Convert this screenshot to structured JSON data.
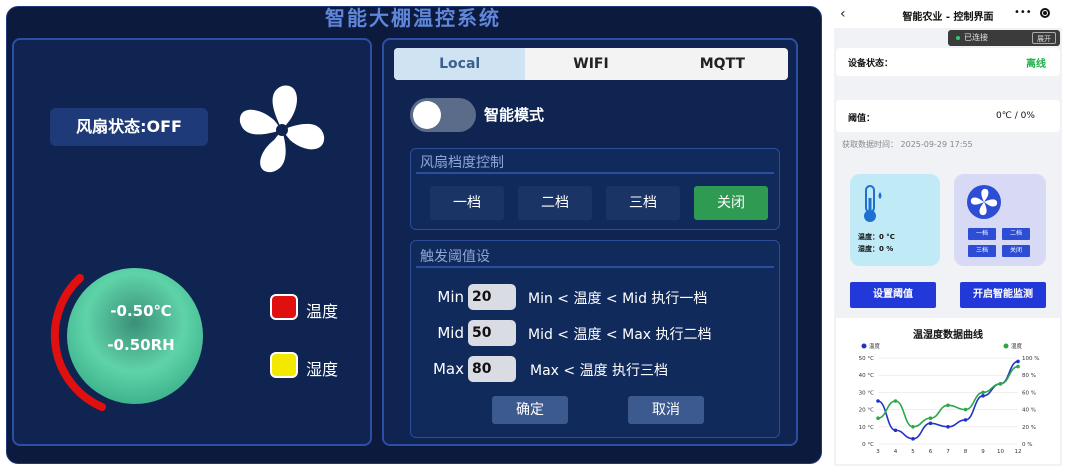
{
  "hmi": {
    "title": "智能大棚温控系统",
    "fan_status": "风扇状态:OFF",
    "temperature": "-0.50℃",
    "humidity": "-0.50RH",
    "legend": [
      {
        "label": "温度",
        "color": "#e01010"
      },
      {
        "label": "湿度",
        "color": "#f2e800"
      }
    ],
    "tabs": [
      "Local",
      "WIFI",
      "MQTT"
    ],
    "active_tab": "Local",
    "smart_mode_label": "智能模式",
    "smart_mode_on": false,
    "speed_title": "风扇档度控制",
    "speed_buttons": [
      "一档",
      "二档",
      "三档",
      "关闭"
    ],
    "active_speed": "关闭",
    "threshold_title": "触发阈值设",
    "thresholds": [
      {
        "label": "Min",
        "value": "20",
        "desc": "Min < 温度 < Mid 执行一档"
      },
      {
        "label": "Mid",
        "value": "50",
        "desc": "Mid < 温度 < Max 执行二档"
      },
      {
        "label": "Max",
        "value": "80",
        "desc": "Max < 温度 执行三档"
      }
    ],
    "confirm_label": "确定",
    "cancel_label": "取消",
    "colors": {
      "bg": "#0b1a3d",
      "active_green": "#2e9a52",
      "gauge_red": "#e01010"
    }
  },
  "phone": {
    "title": "智能农业 - 控制界面",
    "back_icon": "chevron-left-icon",
    "menu_icon": "more-dots-icon",
    "connection_text": "已连接",
    "expand_label": "展开",
    "device_status_label": "设备状态：",
    "device_status_value": "离线",
    "threshold_label": "阈值：",
    "threshold_value": "0℃ / 0%",
    "fetch_time": "获取数据时间： 2025-09-29 17:55",
    "sensor_temp": "温度：0 °C",
    "sensor_hum": "湿度：0 %",
    "fan_buttons": [
      "一档",
      "二档",
      "三档",
      "关闭"
    ],
    "set_threshold_label": "设置阈值",
    "smart_monitor_label": "开启智能监测",
    "colors": {
      "online": "#20b04a",
      "primary": "#2338d8"
    }
  },
  "chart_data": {
    "type": "line",
    "title": "温湿度数据曲线",
    "legend_position": "top",
    "x": [
      3,
      4,
      5,
      6,
      7,
      8,
      9,
      10,
      12
    ],
    "y_left_ticks": [
      "50 °C",
      "40 °C",
      "30 °C",
      "20 °C",
      "10 °C",
      "0 °C"
    ],
    "y_right_ticks": [
      "100 %",
      "80 %",
      "60 %",
      "40 %",
      "20 %",
      "0 %"
    ],
    "x_tick_labels": [
      "3",
      "4",
      "5",
      "6",
      "7",
      "8",
      "9",
      "10",
      "12"
    ],
    "ylim_left": [
      0,
      50
    ],
    "ylim_right": [
      0,
      100
    ],
    "series": [
      {
        "name": "温度",
        "axis": "left",
        "color": "#2232c8",
        "values": [
          25,
          8,
          3,
          12,
          10,
          14,
          28,
          35,
          48
        ]
      },
      {
        "name": "湿度",
        "axis": "right",
        "color": "#2aa84a",
        "values": [
          30,
          50,
          20,
          30,
          45,
          40,
          60,
          70,
          90
        ]
      }
    ]
  }
}
